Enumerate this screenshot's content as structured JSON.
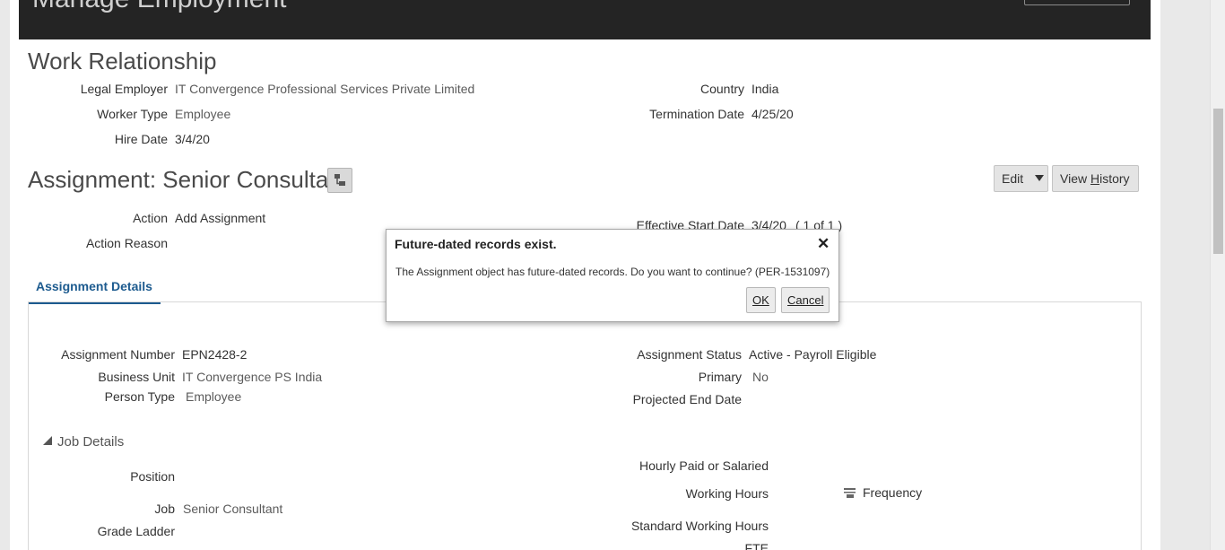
{
  "header": {
    "title": "Manage Employment"
  },
  "work_relationship": {
    "title": "Work Relationship",
    "legal_employer_label": "Legal Employer",
    "legal_employer": "IT Convergence Professional Services Private Limited",
    "worker_type_label": "Worker Type",
    "worker_type": "Employee",
    "hire_date_label": "Hire Date",
    "hire_date": "3/4/20",
    "country_label": "Country",
    "country": "India",
    "termination_date_label": "Termination Date",
    "termination_date": "4/25/20"
  },
  "assignment": {
    "title": "Assignment: Senior Consultant",
    "edit_label": "Edit",
    "view_history_pre": "View ",
    "view_history_u": "H",
    "view_history_post": "istory",
    "action_label": "Action",
    "action": "Add Assignment",
    "action_reason_label": "Action Reason",
    "effective_start_label": "Effective Start Date",
    "effective_start": "3/4/20",
    "pager": "( 1 of 1 )"
  },
  "tabs": [
    {
      "label": "Assignment Details"
    }
  ],
  "details": {
    "assignment_number_label": "Assignment Number",
    "assignment_number": "EPN2428-2",
    "business_unit_label": "Business Unit",
    "business_unit": "IT Convergence PS India",
    "person_type_label": "Person Type",
    "person_type": "Employee",
    "assignment_status_label": "Assignment Status",
    "assignment_status": "Active - Payroll Eligible",
    "primary_label": "Primary",
    "primary": "No",
    "projected_end_label": "Projected End Date"
  },
  "job_details": {
    "title": "Job Details",
    "position_label": "Position",
    "job_label": "Job",
    "job": "Senior Consultant",
    "grade_ladder_label": "Grade Ladder",
    "hourly_label": "Hourly Paid or Salaried",
    "working_hours_label": "Working Hours",
    "frequency_label": "Frequency",
    "standard_hours_label": "Standard Working Hours",
    "fte_label": "FTE"
  },
  "dialog": {
    "title": "Future-dated records exist.",
    "close_glyph": "✕",
    "message": "The Assignment object has future-dated records. Do you want to continue? (PER-1531097)",
    "ok_label": "OK",
    "cancel_label": "Cancel"
  },
  "icons": {
    "close": "close-icon",
    "edit_dropdown": "chevron-down-icon",
    "hierarchy": "hierarchy-icon",
    "frequency": "frequency-icon",
    "collapse": "triangle-collapse-icon"
  },
  "colors": {
    "header_bg": "#242424",
    "tab_accent": "#1d5b8f",
    "page_bg": "#ffffff"
  }
}
